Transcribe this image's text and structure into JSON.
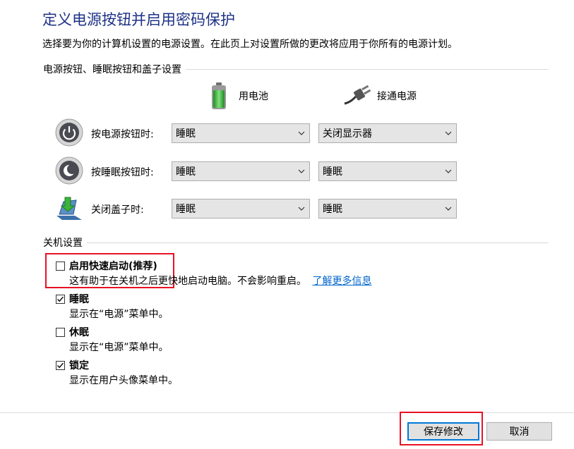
{
  "page": {
    "title": "定义电源按钮并启用密码保护",
    "description": "选择要为你的计算机设置的电源设置。在此页上对设置所做的更改将应用于你所有的电源计划。"
  },
  "power_section": {
    "heading": "电源按钮、睡眠按钮和盖子设置",
    "columns": {
      "battery": "用电池",
      "plugged": "接通电源"
    },
    "rows": [
      {
        "label": "按电源按钮时:",
        "battery": "睡眠",
        "plugged": "关闭显示器",
        "icon": "power-icon"
      },
      {
        "label": "按睡眠按钮时:",
        "battery": "睡眠",
        "plugged": "睡眠",
        "icon": "sleep-moon-icon"
      },
      {
        "label": "关闭盖子时:",
        "battery": "睡眠",
        "plugged": "睡眠",
        "icon": "laptop-lid-icon"
      }
    ]
  },
  "shutdown_section": {
    "heading": "关机设置",
    "options": [
      {
        "label": "启用快速启动(推荐)",
        "desc": "这有助于在关机之后更快地启动电脑。不会影响重启。",
        "link": "了解更多信息",
        "checked": false
      },
      {
        "label": "睡眠",
        "desc": "显示在“电源”菜单中。",
        "checked": true
      },
      {
        "label": "休眠",
        "desc": "显示在“电源”菜单中。",
        "checked": false
      },
      {
        "label": "锁定",
        "desc": "显示在用户头像菜单中。",
        "checked": true
      }
    ]
  },
  "buttons": {
    "save": "保存修改",
    "cancel": "取消"
  },
  "colors": {
    "title": "#1e3287",
    "link": "#0066cc",
    "highlight": "#e81123",
    "focus": "#0078d7"
  }
}
